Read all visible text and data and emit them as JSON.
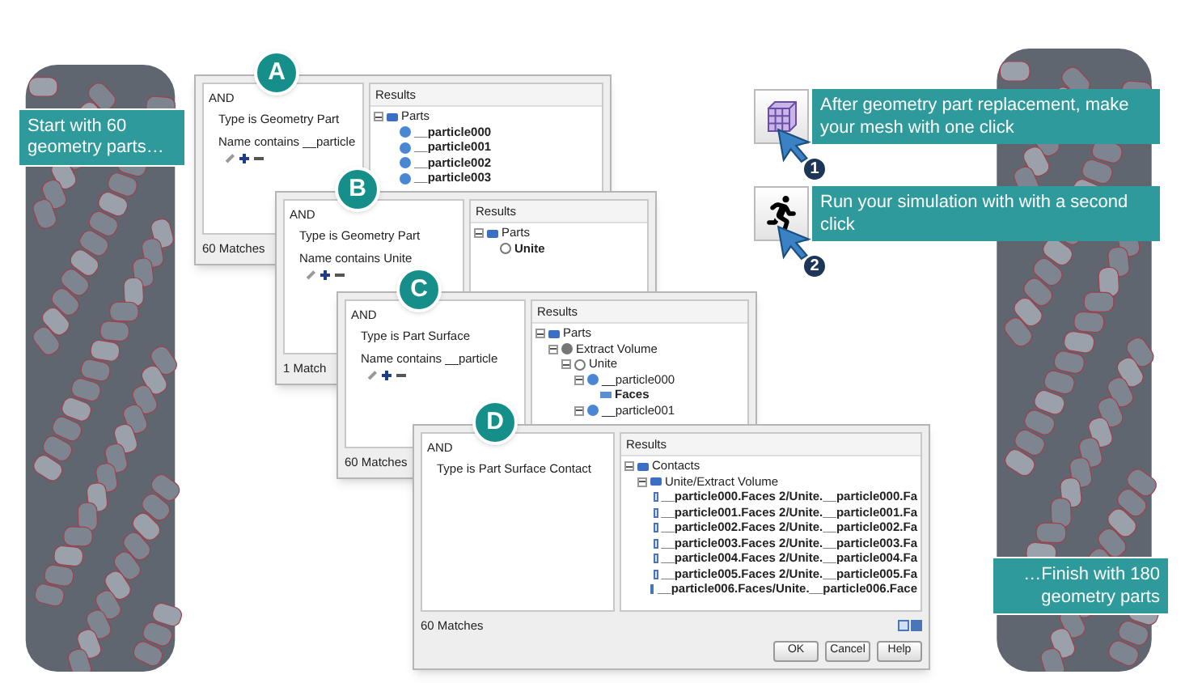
{
  "intro_callout": "Start with 60 geometry parts…",
  "dialogs": [
    {
      "badge": "A",
      "conditions_header": "AND",
      "conditions": [
        "Type is Geometry Part",
        "Name contains __particle"
      ],
      "show_edit_tools": true,
      "results_header": "Results",
      "results": [
        {
          "label": "Parts",
          "kind": "folder",
          "bold": false,
          "expanded": true,
          "children": [
            {
              "label": "__particle000",
              "kind": "part",
              "bold": true
            },
            {
              "label": "__particle001",
              "kind": "part",
              "bold": true
            },
            {
              "label": "__particle002",
              "kind": "part",
              "bold": true
            },
            {
              "label": "__particle003",
              "kind": "part",
              "bold": true
            }
          ]
        }
      ],
      "matches": "60 Matches"
    },
    {
      "badge": "B",
      "conditions_header": "AND",
      "conditions": [
        "Type is Geometry Part",
        "Name contains Unite"
      ],
      "show_edit_tools": true,
      "results_header": "Results",
      "results": [
        {
          "label": "Parts",
          "kind": "folder",
          "bold": false,
          "expanded": true,
          "children": [
            {
              "label": "Unite",
              "kind": "volume",
              "bold": true
            }
          ]
        }
      ],
      "matches": "1 Match"
    },
    {
      "badge": "C",
      "conditions_header": "AND",
      "conditions": [
        "Type is Part Surface",
        "Name contains __particle"
      ],
      "show_edit_tools": true,
      "results_header": "Results",
      "results": [
        {
          "label": "Parts",
          "kind": "folder",
          "bold": false,
          "expanded": true,
          "children": [
            {
              "label": "Extract Volume",
              "kind": "solid",
              "bold": false,
              "expanded": true,
              "children": [
                {
                  "label": "Unite",
                  "kind": "volume",
                  "bold": false,
                  "expanded": true,
                  "children": [
                    {
                      "label": "__particle000",
                      "kind": "part",
                      "bold": false,
                      "expanded": true,
                      "children": [
                        {
                          "label": "Faces",
                          "kind": "face",
                          "bold": true
                        }
                      ]
                    },
                    {
                      "label": "__particle001",
                      "kind": "part",
                      "bold": false,
                      "expanded": true
                    }
                  ]
                }
              ]
            }
          ]
        }
      ],
      "matches": "60 Matches"
    },
    {
      "badge": "D",
      "conditions_header": "AND",
      "conditions": [
        "Type is Part Surface Contact"
      ],
      "show_edit_tools": false,
      "results_header": "Results",
      "results": [
        {
          "label": "Contacts",
          "kind": "folder",
          "bold": false,
          "expanded": true,
          "children": [
            {
              "label": "Unite/Extract Volume",
              "kind": "folder",
              "bold": false,
              "expanded": true,
              "children": [
                {
                  "label": "__particle000.Faces 2/Unite.__particle000.Fa",
                  "kind": "contact",
                  "bold": true
                },
                {
                  "label": "__particle001.Faces 2/Unite.__particle001.Fa",
                  "kind": "contact",
                  "bold": true
                },
                {
                  "label": "__particle002.Faces 2/Unite.__particle002.Fa",
                  "kind": "contact",
                  "bold": true
                },
                {
                  "label": "__particle003.Faces 2/Unite.__particle003.Fa",
                  "kind": "contact",
                  "bold": true
                },
                {
                  "label": "__particle004.Faces 2/Unite.__particle004.Fa",
                  "kind": "contact",
                  "bold": true
                },
                {
                  "label": "__particle005.Faces 2/Unite.__particle005.Fa",
                  "kind": "contact",
                  "bold": true
                },
                {
                  "label": "__particle006.Faces/Unite.__particle006.Face",
                  "kind": "contact",
                  "bold": true
                }
              ]
            }
          ]
        }
      ],
      "matches": "60 Matches",
      "buttons": [
        "OK",
        "Cancel",
        "Help"
      ]
    }
  ],
  "steps": [
    {
      "number": "1",
      "kind": "mesh",
      "text": "After geometry part replacement, make your mesh with one click"
    },
    {
      "number": "2",
      "kind": "run",
      "text": "Run your simulation with with a second click"
    }
  ],
  "outro_callout": "…Finish with 180 geometry parts"
}
